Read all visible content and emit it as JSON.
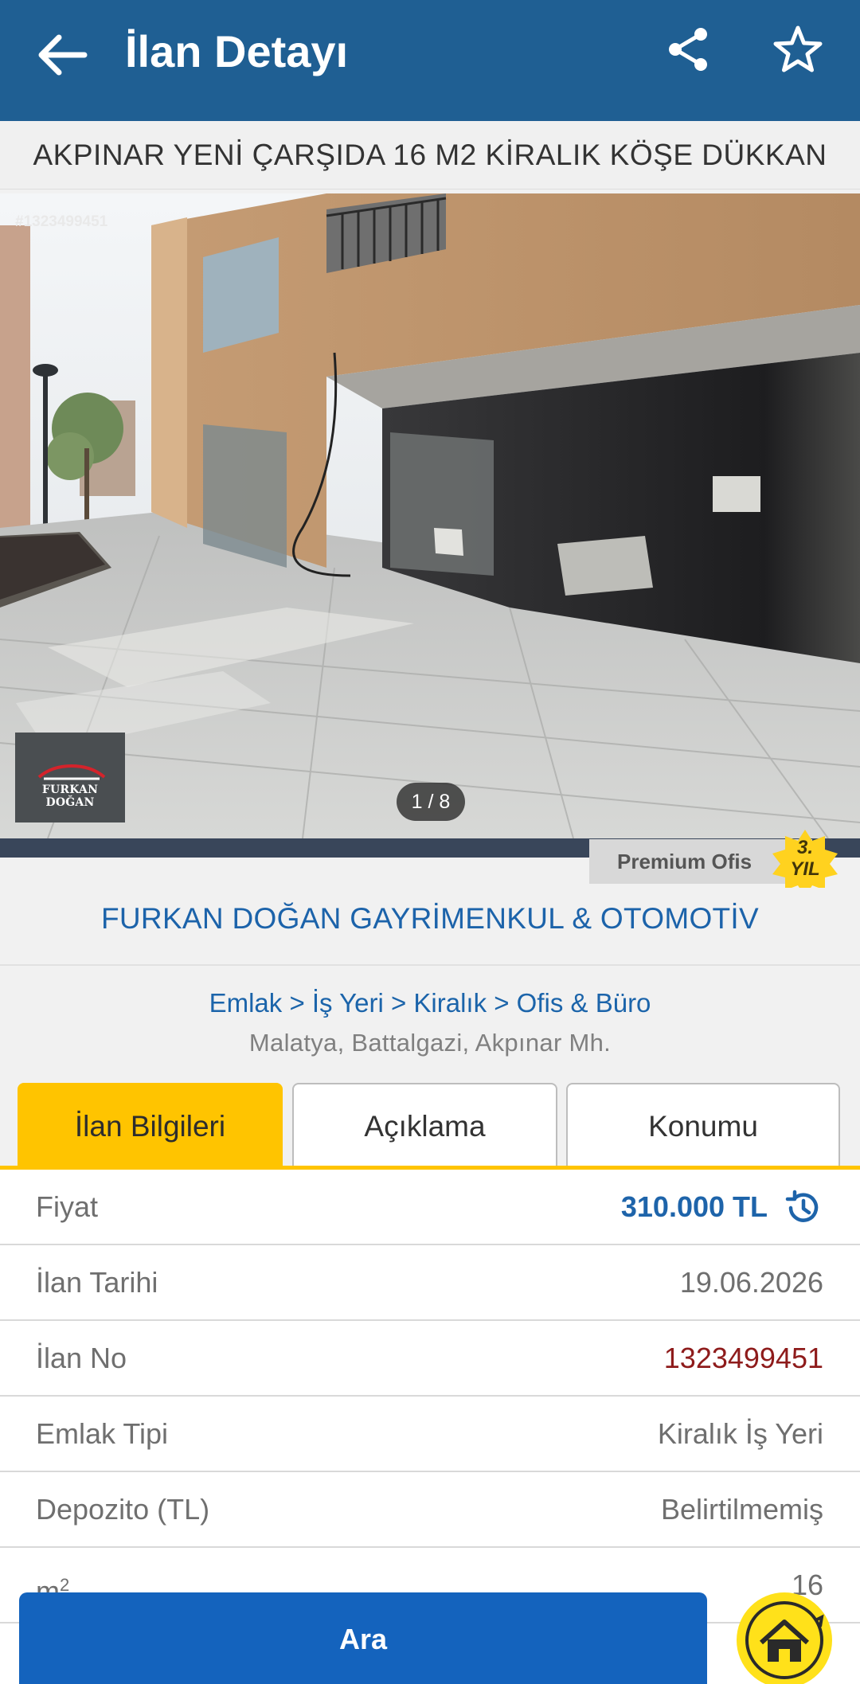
{
  "header": {
    "title": "İlan Detayı"
  },
  "listing": {
    "title": "AKPINAR YENİ ÇARŞIDA 16 M2 KİRALIK KÖŞE DÜKKAN",
    "photo_id": "#1323499451",
    "photo_counter": "1 / 8",
    "photo_logo_text": "FURKAN DOĞAN",
    "premium_label": "Premium Ofis",
    "badge_line1": "3.",
    "badge_line2": "YIL",
    "agency_name": "FURKAN DOĞAN GAYRİMENKUL & OTOMOTİV",
    "breadcrumb": "Emlak > İş Yeri > Kiralık > Ofis & Büro",
    "location": "Malatya, Battalgazi, Akpınar Mh."
  },
  "tabs": [
    {
      "label": "İlan Bilgileri",
      "active": true
    },
    {
      "label": "Açıklama",
      "active": false
    },
    {
      "label": "Konumu",
      "active": false
    }
  ],
  "details": [
    {
      "key": "Fiyat",
      "value": "310.000 TL"
    },
    {
      "key": "İlan Tarihi",
      "value": "19.06.2026"
    },
    {
      "key": "İlan No",
      "value": "1323499451"
    },
    {
      "key": "Emlak Tipi",
      "value": "Kiralık İş Yeri"
    },
    {
      "key": "Depozito (TL)",
      "value": "Belirtilmemiş"
    },
    {
      "key": "m",
      "key_sup": "2",
      "value": "16"
    }
  ],
  "actions": {
    "call_label": "Ara"
  },
  "colors": {
    "header": "#1f5f93",
    "accent_yellow": "#ffc400",
    "link_blue": "#1c63aa",
    "call_button": "#1463bd",
    "listing_no": "#8e1b1b"
  },
  "icons": [
    "back-arrow-icon",
    "share-icon",
    "star-icon",
    "history-icon",
    "home-icon"
  ]
}
